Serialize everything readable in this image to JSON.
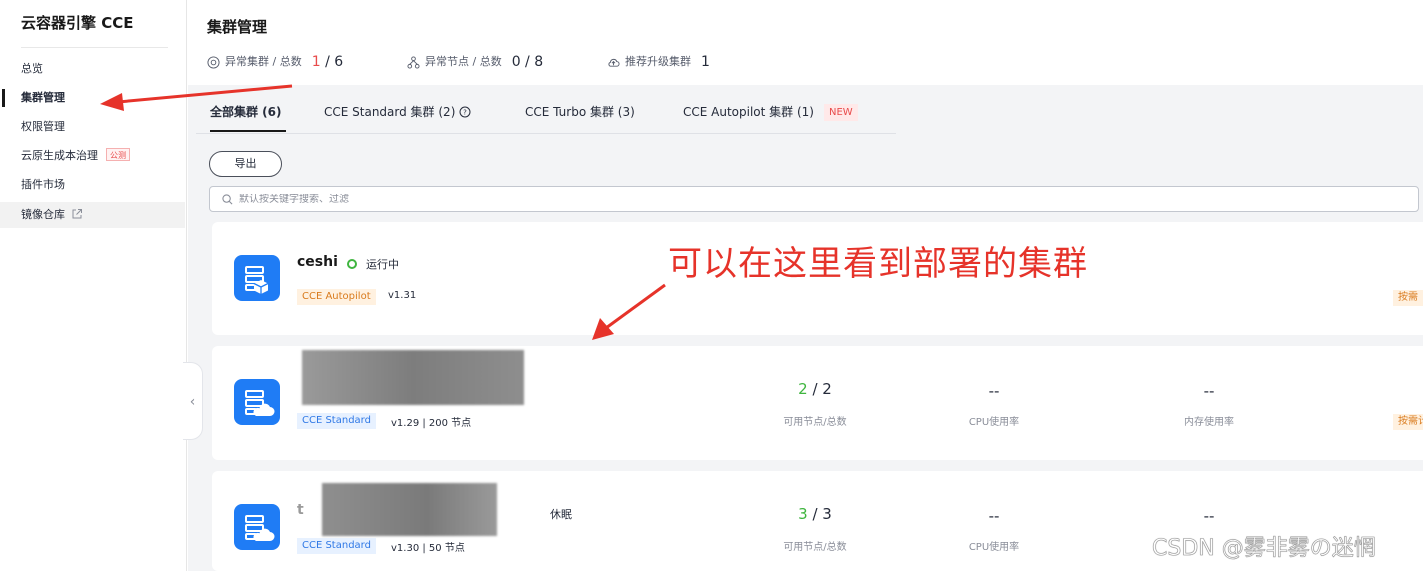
{
  "sidebar": {
    "title": "云容器引擎 CCE",
    "items": [
      {
        "label": "总览"
      },
      {
        "label": "集群管理"
      },
      {
        "label": "权限管理"
      },
      {
        "label": "云原生成本治理",
        "badge": "公测"
      },
      {
        "label": "插件市场"
      },
      {
        "label": "镜像仓库"
      }
    ]
  },
  "header": {
    "title": "集群管理",
    "stats": [
      {
        "label": "异常集群 / 总数",
        "abnormal": "1",
        "total": "6"
      },
      {
        "label": "异常节点 / 总数",
        "value": "0 / 8"
      },
      {
        "label": "推荐升级集群",
        "value": "1"
      }
    ]
  },
  "tabs": [
    {
      "label": "全部集群 (6)"
    },
    {
      "label": "CCE Standard 集群 (2)"
    },
    {
      "label": "CCE Turbo 集群 (3)"
    },
    {
      "label": "CCE Autopilot 集群 (1)",
      "badge": "NEW"
    }
  ],
  "toolbar": {
    "export_label": "导出",
    "search_placeholder": "默认按关键字搜索、过滤"
  },
  "clusters": [
    {
      "name": "ceshi",
      "status": "运行中",
      "type": "CCE Autopilot",
      "version": "v1.31",
      "billing": "按需"
    },
    {
      "type": "CCE Standard",
      "version": "v1.29 | 200 节点",
      "nodes_ok": "2",
      "nodes_total": "2",
      "nodes_label": "可用节点/总数",
      "cpu": "--",
      "cpu_label": "CPU使用率",
      "mem": "--",
      "mem_label": "内存使用率",
      "billing": "按需计"
    },
    {
      "name_prefix": "t",
      "status": "休眠",
      "type": "CCE Standard",
      "version": "v1.30 | 50 节点",
      "nodes_ok": "3",
      "nodes_total": "3",
      "nodes_label": "可用节点/总数",
      "cpu": "--",
      "cpu_label": "CPU使用率",
      "mem": "--"
    }
  ],
  "annotation": {
    "text": "可以在这里看到部署的集群"
  },
  "watermark": "CSDN @雾非雾の迷惘",
  "colors": {
    "accent_red": "#e6332a",
    "primary_blue": "#1f7cf5",
    "running_green": "#3fb53f"
  }
}
